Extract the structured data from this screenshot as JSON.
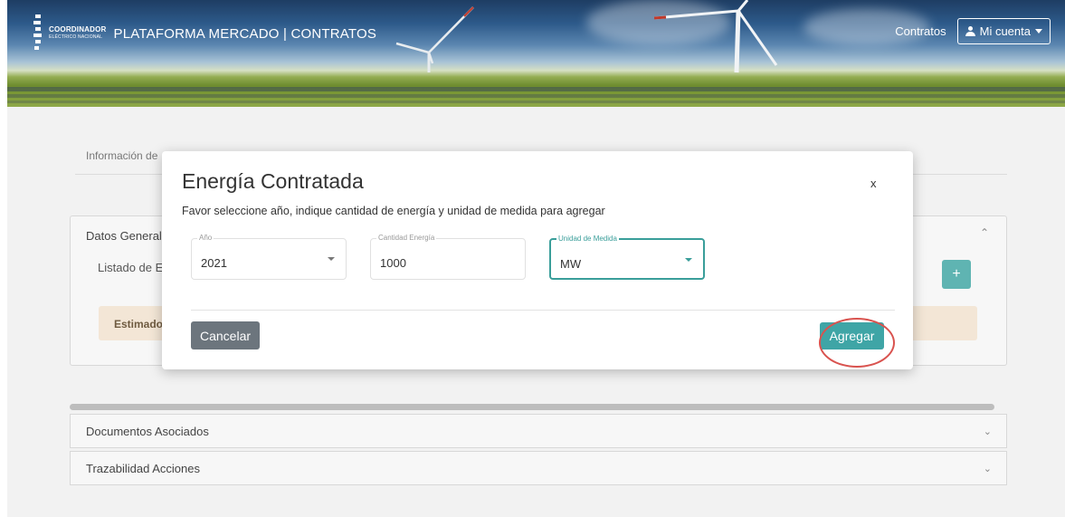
{
  "header": {
    "brand_small": "COORDINADOR",
    "brand_small_sub": "ELÉCTRICO NACIONAL",
    "brand_title": "PLATAFORMA MERCADO | CONTRATOS",
    "nav_contracts": "Contratos",
    "account_label": "Mi cuenta"
  },
  "page": {
    "tab_info": "Información de",
    "general_title": "Datos General",
    "general_subtitle": "Listado de E",
    "alert_text": "Estimado",
    "add_symbol": "+",
    "accordions": [
      {
        "label": "Documentos Asociados"
      },
      {
        "label": "Trazabilidad Acciones"
      }
    ]
  },
  "modal": {
    "title": "Energía Contratada",
    "close_symbol": "x",
    "description": "Favor seleccione año, indique cantidad de energía y unidad de medida para agregar",
    "fields": {
      "year": {
        "label": "Año",
        "value": "2021"
      },
      "quantity": {
        "label": "Cantidad Energía",
        "value": "1000"
      },
      "unit": {
        "label": "Unidad de Medida",
        "value": "MW"
      }
    },
    "cancel_label": "Cancelar",
    "add_label": "Agregar"
  },
  "colors": {
    "teal_accent": "#3fa5a6",
    "cancel_gray": "#6c757d",
    "highlight_red": "#d9534f",
    "alert_bg": "#f3e6d6"
  },
  "icons": [
    "user-icon",
    "caret-down-icon",
    "close-icon",
    "chevron-up-icon",
    "chevron-down-icon",
    "plus-icon",
    "dropdown-arrow-icon"
  ]
}
